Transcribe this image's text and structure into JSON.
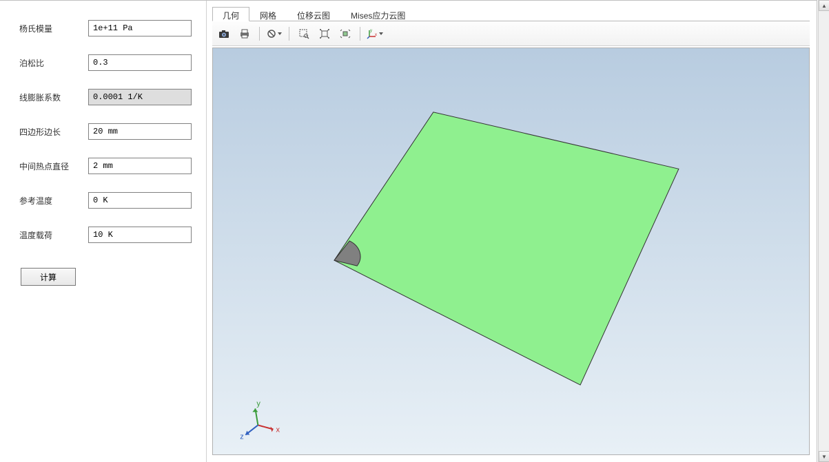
{
  "form": {
    "fields": [
      {
        "label": "杨氏模量",
        "value": "1e+11 Pa",
        "highlighted": false
      },
      {
        "label": "泊松比",
        "value": "0.3",
        "highlighted": false
      },
      {
        "label": "线膨胀系数",
        "value": "0.0001 1/K",
        "highlighted": true
      },
      {
        "label": "四边形边长",
        "value": "20 mm",
        "highlighted": false
      },
      {
        "label": "中间热点直径",
        "value": "2 mm",
        "highlighted": false
      },
      {
        "label": "参考温度",
        "value": "0 K",
        "highlighted": false
      },
      {
        "label": "温度载荷",
        "value": "10 K",
        "highlighted": false
      }
    ],
    "calc_button": "计算"
  },
  "tabs": [
    {
      "label": "几何",
      "active": true
    },
    {
      "label": "网格",
      "active": false
    },
    {
      "label": "位移云图",
      "active": false
    },
    {
      "label": "Mises应力云图",
      "active": false
    }
  ],
  "toolbar_icons": {
    "camera": "camera-icon",
    "print": "print-icon",
    "reset": "reset-icon",
    "zoom_box": "zoom-box-icon",
    "zoom_extents": "zoom-extents-icon",
    "zoom_selected": "zoom-selected-icon",
    "axis_triad": "axis-triad-icon"
  },
  "axis_labels": {
    "x": "x",
    "y": "y",
    "z": "z"
  },
  "colors": {
    "plate": "#8FF08F",
    "plate_stroke": "#333333",
    "hotspot": "#808080",
    "canvas_top": "#b8cce0",
    "canvas_bottom": "#e8f0f6"
  }
}
